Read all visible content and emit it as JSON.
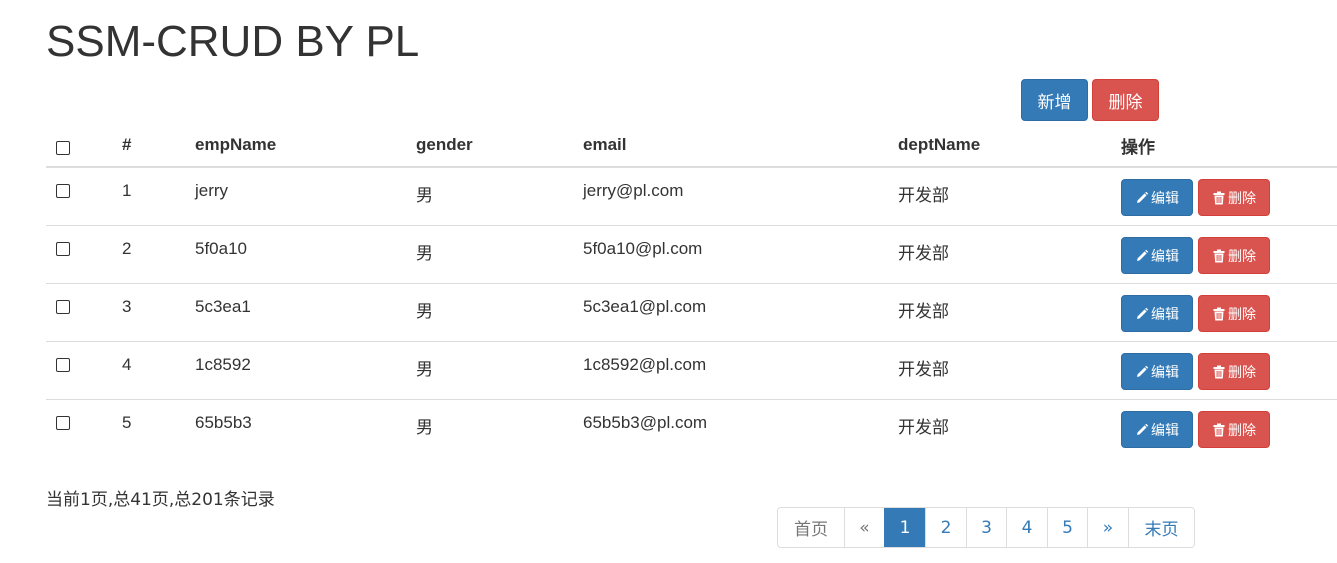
{
  "page": {
    "title": "SSM-CRUD BY PL"
  },
  "toolbar": {
    "add_label": "新增",
    "delete_label": "删除"
  },
  "table": {
    "headers": [
      "#",
      "empName",
      "gender",
      "email",
      "deptName",
      "操作"
    ],
    "rows": [
      {
        "id": "1",
        "empName": "jerry",
        "gender": "男",
        "email": "jerry@pl.com",
        "deptName": "开发部"
      },
      {
        "id": "2",
        "empName": "5f0a10",
        "gender": "男",
        "email": "5f0a10@pl.com",
        "deptName": "开发部"
      },
      {
        "id": "3",
        "empName": "5c3ea1",
        "gender": "男",
        "email": "5c3ea1@pl.com",
        "deptName": "开发部"
      },
      {
        "id": "4",
        "empName": "1c8592",
        "gender": "男",
        "email": "1c8592@pl.com",
        "deptName": "开发部"
      },
      {
        "id": "5",
        "empName": "65b5b3",
        "gender": "男",
        "email": "65b5b3@pl.com",
        "deptName": "开发部"
      }
    ],
    "row_actions": {
      "edit_label": "编辑",
      "delete_label": "删除",
      "edit_icon": "pencil-icon",
      "delete_icon": "trash-icon"
    }
  },
  "pagination_info": "当前1页,总41页,总201条记录",
  "pagination": {
    "first": "首页",
    "prev": "«",
    "pages": [
      "1",
      "2",
      "3",
      "4",
      "5"
    ],
    "current": "1",
    "next": "»",
    "last": "末页"
  },
  "colors": {
    "primary": "#337ab7",
    "danger": "#d9534f",
    "border": "#dddddd",
    "text": "#333333"
  }
}
